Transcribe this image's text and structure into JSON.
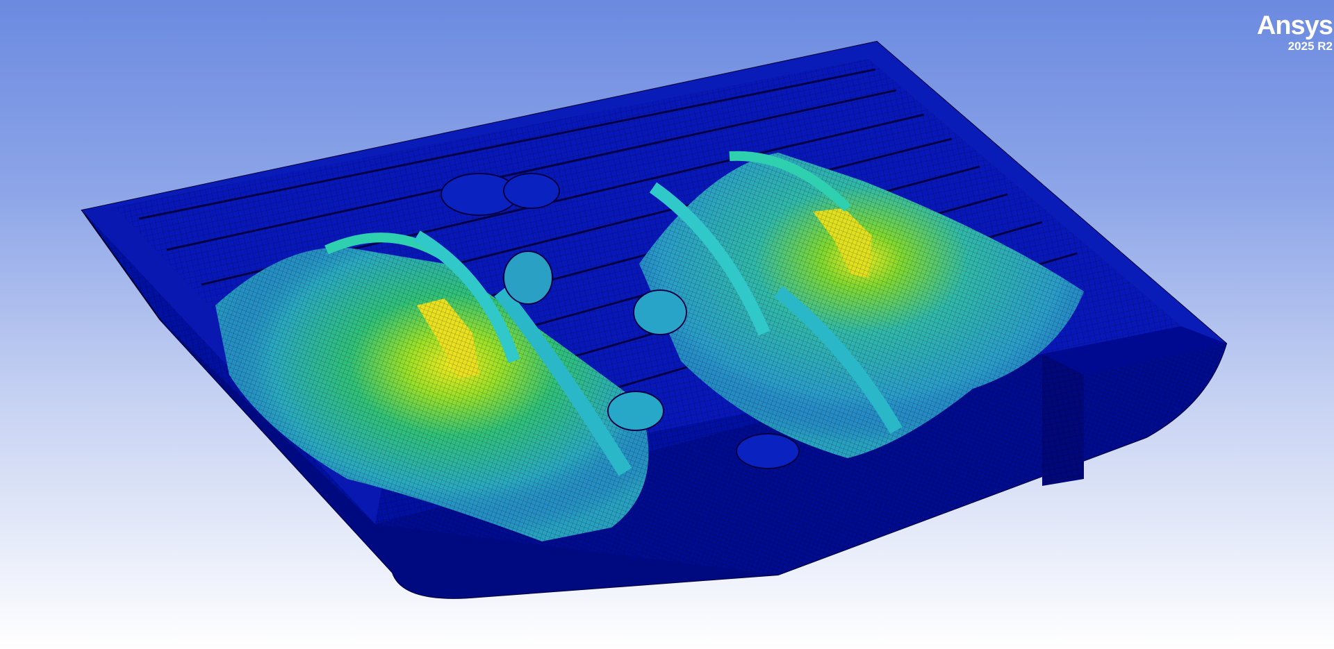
{
  "viewport": {
    "background_top": "#6b8ae0",
    "background_bottom": "#ffffff"
  },
  "model": {
    "description_colors": {
      "base": "#0010a8",
      "low": "#1d5fd0",
      "mid": "#2fc0c8",
      "high": "#2ed070",
      "peak": "#e8e820"
    }
  },
  "branding": {
    "logo_text": "Ansys",
    "version": "2025 R2"
  }
}
